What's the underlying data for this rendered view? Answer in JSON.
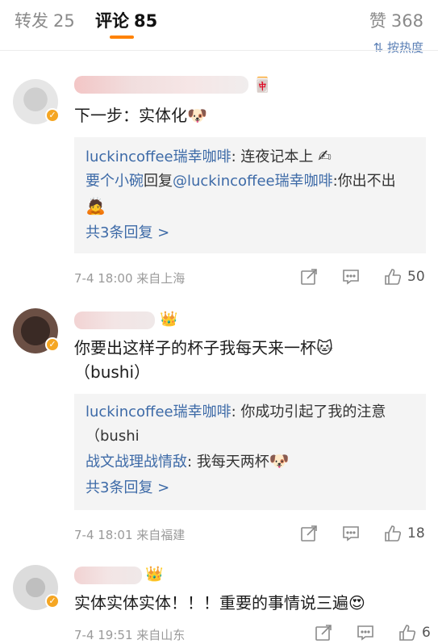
{
  "tabs": {
    "repost": {
      "label": "转发",
      "count": "25"
    },
    "comment": {
      "label": "评论",
      "count": "85"
    },
    "like": {
      "label": "赞",
      "count": "368"
    }
  },
  "sort_button": "按热度",
  "comments": [
    {
      "text": "下一步：实体化",
      "emoji": "🐶",
      "replies": [
        {
          "name": "luckincoffee瑞幸咖啡",
          "sep": ": ",
          "text": "连夜记本上",
          "emoji": "✍"
        },
        {
          "name": "要个小碗",
          "mid": "回复",
          "name2": "@luckincoffee瑞幸咖啡",
          "sep": ":",
          "text": "你出不出",
          "emoji": "🙇"
        }
      ],
      "more": "共3条回复 >",
      "time": "7-4 18:00",
      "location": "来自上海",
      "likes": "50"
    },
    {
      "text": "你要出这样子的杯子我每天来一杯",
      "emoji": "🐱",
      "text2": "（bushi）",
      "replies": [
        {
          "name": "luckincoffee瑞幸咖啡",
          "sep": ": ",
          "text": "你成功引起了我的注意（bushi"
        },
        {
          "name": "战文战理战情敌",
          "sep": ": ",
          "text": "我每天两杯",
          "emoji": "🐶"
        }
      ],
      "more": "共3条回复 >",
      "time": "7-4 18:01",
      "location": "来自福建",
      "likes": "18"
    },
    {
      "text": "实体实体实体！！！重要的事情说三遍",
      "emoji": "😍",
      "time": "7-4 19:51",
      "location": "来自山东",
      "likes": "6"
    }
  ],
  "colors": {
    "accent": "#ff8200",
    "link": "#3d6aa7",
    "muted": "#9a9a9a"
  },
  "icons": [
    "repost-icon",
    "comment-icon",
    "thumbs-up-icon",
    "verified-badge-icon",
    "crown-icon"
  ]
}
